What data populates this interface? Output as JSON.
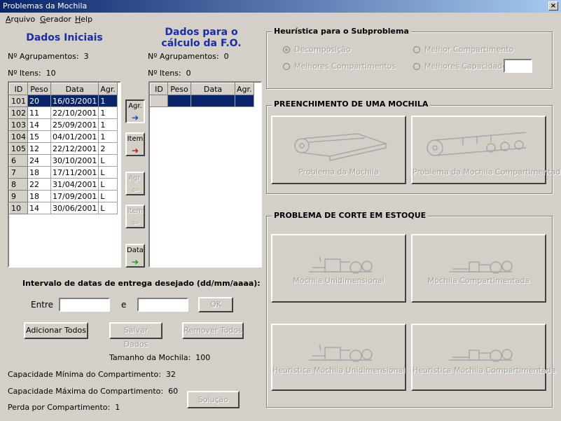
{
  "window": {
    "title": "Problemas da Mochila",
    "close": "×"
  },
  "menu": [
    "Arquivo",
    "Gerador",
    "Help"
  ],
  "left": {
    "heading": "Dados Iniciais",
    "groups_label": "Nº Agrupamentos:",
    "groups_value": "3",
    "items_label": "Nº Itens:",
    "items_value": "10",
    "columns": [
      "ID",
      "Peso",
      "Data",
      "Agr."
    ],
    "rows": [
      [
        "101",
        "20",
        "16/03/2001",
        "1"
      ],
      [
        "102",
        "11",
        "22/10/2001",
        "1"
      ],
      [
        "103",
        "14",
        "25/09/2001",
        "1"
      ],
      [
        "104",
        "15",
        "04/01/2001",
        "1"
      ],
      [
        "105",
        "12",
        "22/12/2001",
        "2"
      ],
      [
        "6",
        "24",
        "30/10/2001",
        "L"
      ],
      [
        "7",
        "18",
        "17/11/2001",
        "L"
      ],
      [
        "8",
        "22",
        "31/04/2001",
        "L"
      ],
      [
        "9",
        "18",
        "17/09/2001",
        "L"
      ],
      [
        "10",
        "14",
        "30/06/2001",
        "L"
      ]
    ]
  },
  "right": {
    "heading1": "Dados para o",
    "heading2": "cálculo da F.O.",
    "groups_label": "Nº Agrupamentos:",
    "groups_value": "0",
    "items_label": "Nº Itens:",
    "items_value": "0",
    "columns": [
      "ID",
      "Peso",
      "Data",
      "Agr."
    ]
  },
  "transfer": {
    "agr_right": "Agr.",
    "item_right": "Item",
    "agr_left": "Agr.",
    "item_left": "Item",
    "data_right": "Data",
    "arrow_right": "➔",
    "arrow_left": "⇦"
  },
  "dates": {
    "title": "Intervalo de datas de entrega desejado (dd/mm/aaaa):",
    "between": "Entre",
    "and": "e",
    "start_value": "",
    "end_value": "",
    "ok": "OK"
  },
  "actions": {
    "add_all": "Adicionar Todos",
    "save": "Salvar Dados",
    "remove_all": "Remover Todos"
  },
  "info": {
    "knapsack_size_label": "Tamanho da Mochila:",
    "knapsack_size": "100",
    "min_cap_label": "Capacidade Mínima do Compartimento:",
    "min_cap": "32",
    "max_cap_label": "Capacidade Máxima do Compartimento:",
    "max_cap": "60",
    "loss_label": "Perda por Compartimento:",
    "loss": "1",
    "solution": "Solução"
  },
  "heuristic": {
    "title": "Heurística para o Subproblema",
    "options": [
      "Decomposição",
      "Melhor Compartimento",
      "Melhores Compartimentos",
      "Melhores Capacidades"
    ],
    "capacities_value": ""
  },
  "fill": {
    "title": "PREENCHIMENTO DE UMA MOCHILA",
    "btn1": "Problema da Mochila",
    "btn2": "Problema da Mochila Compartimentada"
  },
  "cut": {
    "title": "PROBLEMA DE CORTE EM ESTOQUE",
    "btn1": "Mochila Unidimensional",
    "btn2": "Mochila Compartimentada",
    "btn3": "Heurística Mochila Unidimensional",
    "btn4": "Heurística Mochila Compartimentada"
  },
  "colors": {
    "title_start": "#0a246a",
    "title_end": "#a6caf0",
    "heading_blue": "#1a2ea0",
    "arrow_blue": "#1a3fc0",
    "arrow_red": "#d01010",
    "arrow_green": "#10a010",
    "face": "#d4d0c8"
  }
}
